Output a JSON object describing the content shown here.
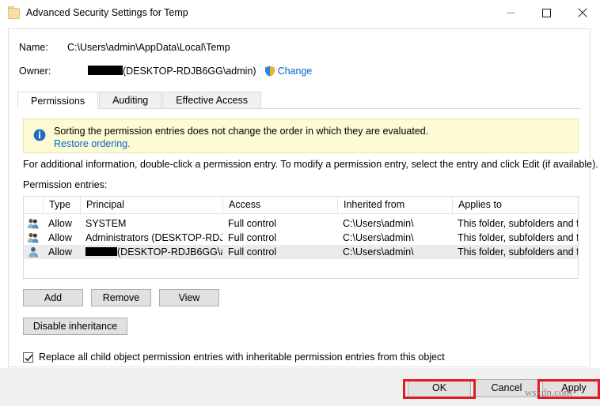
{
  "window": {
    "title": "Advanced Security Settings for Temp",
    "icon": "folder-icon",
    "minimize_label": "─",
    "maximize_label": "□",
    "close_label": "✕"
  },
  "fields": {
    "name_label": "Name:",
    "name_value": "C:\\Users\\admin\\AppData\\Local\\Temp",
    "owner_label": "Owner:",
    "owner_value": "(DESKTOP-RDJB6GG\\admin)",
    "owner_redacted": true,
    "change_link": "Change",
    "change_icon": "uac-shield-icon"
  },
  "tabs": [
    {
      "label": "Permissions",
      "active": true
    },
    {
      "label": "Auditing",
      "active": false
    },
    {
      "label": "Effective Access",
      "active": false
    }
  ],
  "banner": {
    "icon": "info-icon",
    "line1": "Sorting the permission entries does not change the order in which they are evaluated.",
    "line2": "Restore ordering."
  },
  "helper_text": "For additional information, double-click a permission entry. To modify a permission entry, select the entry and click Edit (if available).",
  "entries_label": "Permission entries:",
  "table": {
    "columns": [
      "Type",
      "Principal",
      "Access",
      "Inherited from",
      "Applies to"
    ],
    "rows": [
      {
        "icon": "group-icon",
        "type": "Allow",
        "principal": "SYSTEM",
        "principal_redacted": false,
        "access": "Full control",
        "inherited_from": "C:\\Users\\admin\\",
        "applies_to": "This folder, subfolders and files",
        "selected": false
      },
      {
        "icon": "group-icon",
        "type": "Allow",
        "principal": "Administrators (DESKTOP-RDJ...",
        "principal_redacted": false,
        "access": "Full control",
        "inherited_from": "C:\\Users\\admin\\",
        "applies_to": "This folder, subfolders and files",
        "selected": false
      },
      {
        "icon": "user-icon",
        "type": "Allow",
        "principal": "(DESKTOP-RDJB6GG\\ad...",
        "principal_redacted": true,
        "access": "Full control",
        "inherited_from": "C:\\Users\\admin\\",
        "applies_to": "This folder, subfolders and files",
        "selected": true
      }
    ]
  },
  "buttons": {
    "add": "Add",
    "remove": "Remove",
    "view": "View",
    "disable_inheritance": "Disable inheritance"
  },
  "checkbox": {
    "label": "Replace all child object permission entries with inheritable permission entries from this object",
    "checked": true
  },
  "footer": {
    "ok": "OK",
    "cancel": "Cancel",
    "apply": "Apply"
  },
  "annotations": {
    "highlight_color": "#e01b24",
    "highlighted": [
      "OK",
      "Apply"
    ],
    "watermark": "wsxdn.com"
  }
}
